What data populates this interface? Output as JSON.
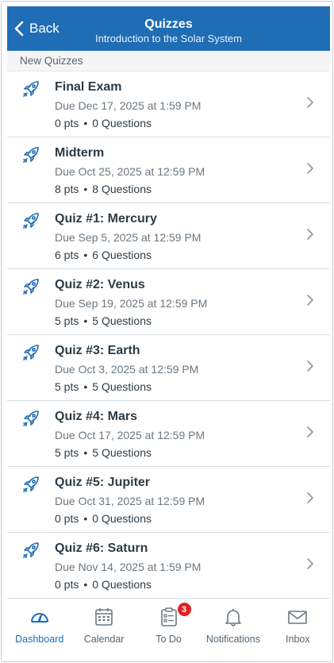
{
  "header": {
    "back_label": "Back",
    "title": "Quizzes",
    "subtitle": "Introduction to the Solar System",
    "color": "#1f6db5"
  },
  "section": {
    "label": "New Quizzes"
  },
  "quizzes": [
    {
      "title": "Final Exam",
      "due": "Due Dec 17, 2025 at 1:59 PM",
      "pts": "0 pts",
      "questions": "0 Questions"
    },
    {
      "title": "Midterm",
      "due": "Due Oct 25, 2025 at 12:59 PM",
      "pts": "8 pts",
      "questions": "8 Questions"
    },
    {
      "title": "Quiz #1: Mercury",
      "due": "Due Sep 5, 2025 at 12:59 PM",
      "pts": "6 pts",
      "questions": "6 Questions"
    },
    {
      "title": "Quiz #2: Venus",
      "due": "Due Sep 19, 2025 at 12:59 PM",
      "pts": "5 pts",
      "questions": "5 Questions"
    },
    {
      "title": "Quiz #3: Earth",
      "due": "Due Oct 3, 2025 at 12:59 PM",
      "pts": "5 pts",
      "questions": "5 Questions"
    },
    {
      "title": "Quiz #4: Mars",
      "due": "Due Oct 17, 2025 at 12:59 PM",
      "pts": "5 pts",
      "questions": "5 Questions"
    },
    {
      "title": "Quiz #5: Jupiter",
      "due": "Due Oct 31, 2025 at 12:59 PM",
      "pts": "0 pts",
      "questions": "0 Questions"
    },
    {
      "title": "Quiz #6: Saturn",
      "due": "Due Nov 14, 2025 at 1:59 PM",
      "pts": "0 pts",
      "questions": "0 Questions"
    }
  ],
  "tabbar": {
    "dashboard": {
      "label": "Dashboard",
      "icon": "dashboard-icon"
    },
    "calendar": {
      "label": "Calendar",
      "icon": "calendar-icon"
    },
    "todo": {
      "label": "To Do",
      "icon": "todo-icon",
      "badge": "3"
    },
    "notifications": {
      "label": "Notifications",
      "icon": "bell-icon"
    },
    "inbox": {
      "label": "Inbox",
      "icon": "envelope-icon"
    }
  }
}
